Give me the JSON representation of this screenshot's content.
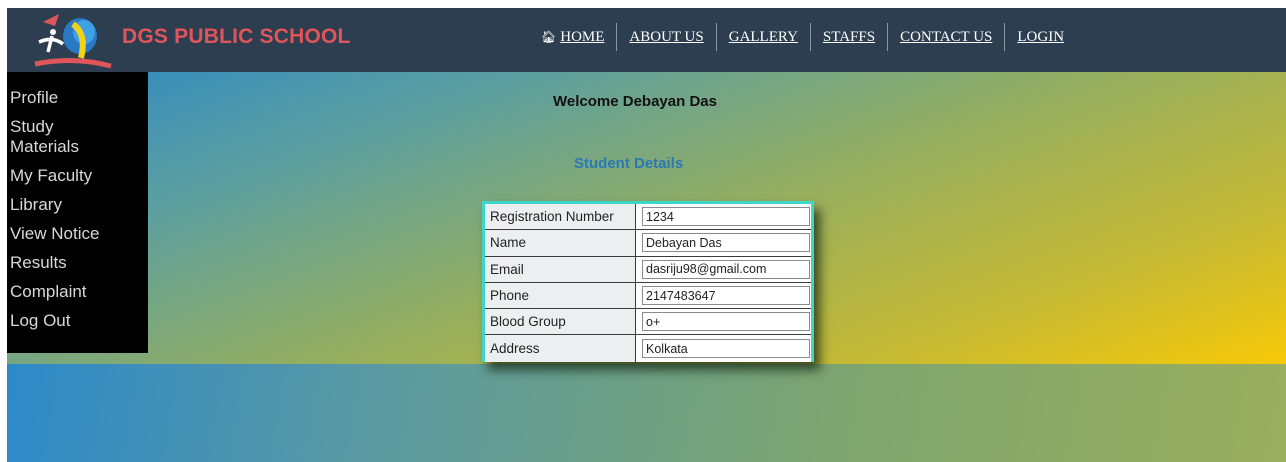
{
  "header": {
    "brand": "DGS PUBLIC SCHOOL",
    "nav": [
      {
        "label": "HOME",
        "icon": "home-icon"
      },
      {
        "label": "ABOUT US"
      },
      {
        "label": "GALLERY"
      },
      {
        "label": "STAFFS"
      },
      {
        "label": "CONTACT US"
      },
      {
        "label": "LOGIN"
      }
    ]
  },
  "sidebar": {
    "items": [
      {
        "label": "Profile"
      },
      {
        "label": "Study Materials"
      },
      {
        "label": "My Faculty"
      },
      {
        "label": "Library"
      },
      {
        "label": "View Notice"
      },
      {
        "label": "Results"
      },
      {
        "label": "Complaint"
      },
      {
        "label": "Log Out"
      }
    ]
  },
  "main": {
    "welcome": "Welcome Debayan Das",
    "section_title": "Student Details",
    "details": [
      {
        "label": "Registration Number",
        "value": "1234"
      },
      {
        "label": "Name",
        "value": "Debayan Das"
      },
      {
        "label": "Email",
        "value": "dasriju98@gmail.com"
      },
      {
        "label": "Phone",
        "value": "2147483647"
      },
      {
        "label": "Blood Group",
        "value": "o+"
      },
      {
        "label": "Address",
        "value": "Kolkata"
      }
    ]
  },
  "colors": {
    "header_bg": "#2d3e50",
    "brand": "#e0555a",
    "section_title": "#2a79b3",
    "table_border": "#3fd5c8"
  }
}
